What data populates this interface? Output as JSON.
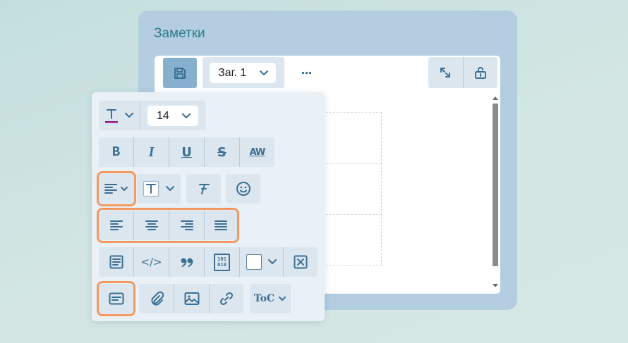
{
  "panel": {
    "title": "Заметки"
  },
  "toolbar": {
    "heading_value": "Заг. 1",
    "more_label": "···"
  },
  "format_popup": {
    "font_size_value": "14",
    "text_style_labels": {
      "bold": "B",
      "italic": "I",
      "underline": "U",
      "strike": "S",
      "kerning": "AW"
    },
    "toc_label": "ToC",
    "code_label": "</>",
    "binary_label_top": "101",
    "binary_label_bottom": "010"
  },
  "colors": {
    "panel_bg": "#b4cde0",
    "save_button_bg": "#87b0cf",
    "button_group_bg": "#dbe6ef",
    "icon_color": "#3d6f92",
    "highlight": "#f39a63",
    "font_color_underline": "#8b1a8b"
  },
  "icons": [
    "save-icon",
    "chevron-down-icon",
    "fullscreen-icon",
    "unlock-icon",
    "text-color-icon",
    "bold-icon",
    "italic-icon",
    "underline-icon",
    "strikethrough-icon",
    "kerning-icon",
    "align-icon",
    "text-box-icon",
    "clear-format-icon",
    "emoji-icon",
    "align-left-icon",
    "align-center-icon",
    "align-right-icon",
    "align-justify-icon",
    "paragraph-icon",
    "code-icon",
    "quote-icon",
    "binary-icon",
    "color-swatch-icon",
    "close-box-icon",
    "card-icon",
    "attach-icon",
    "image-icon",
    "link-icon",
    "toc-icon"
  ]
}
